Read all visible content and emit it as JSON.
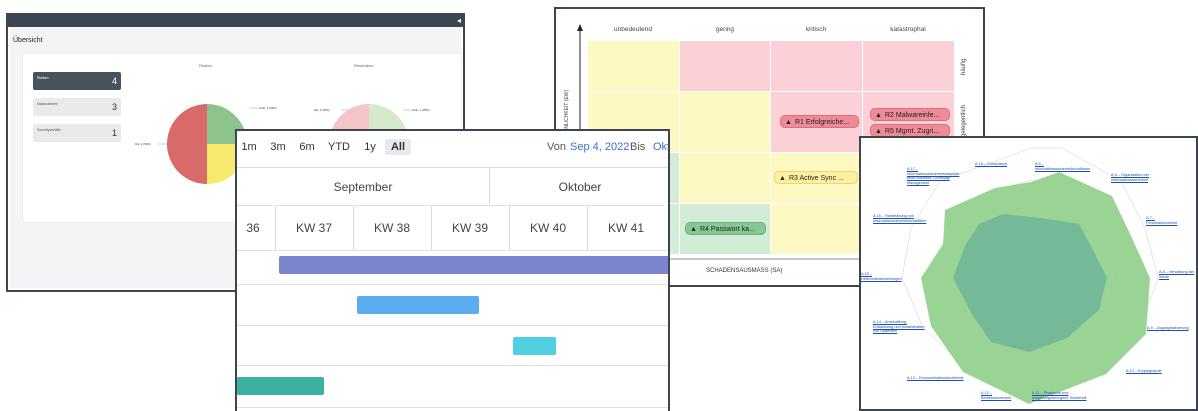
{
  "dashboard": {
    "title": "Übersicht",
    "stats": [
      {
        "label": "Risiken",
        "value": "4"
      },
      {
        "label": "Massnahmen",
        "value": "3"
      },
      {
        "label": "Securityvorfälle",
        "value": "1"
      }
    ],
    "charts": [
      {
        "title": "Risiken",
        "labels": [
          "Gelb: 1 (25%)",
          "Rot: 2 (50%)",
          "Grün: 1 (25%)"
        ]
      },
      {
        "title": "Restrisiken",
        "labels": [
          "Gelb: 1 (25%)",
          "Rot: 2 (50%)",
          "Grün: 1 (25%)"
        ]
      }
    ],
    "colors": {
      "red": "#d86a6a",
      "green": "#8dc48c",
      "yellow": "#f7ea6d",
      "red_light": "#f4c5c9",
      "green_light": "#d5e8cc"
    }
  },
  "risk_matrix": {
    "columns": [
      "unbedeutend",
      "gering",
      "kritisch",
      "katastrophal"
    ],
    "rows": [
      "häufig",
      "gelegentlich"
    ],
    "y_axis_label": "WAHRSCHEINLICHKEIT (EW)",
    "x_axis_label": "SCHADENSAUSMASS (SA)",
    "risks": [
      {
        "id": "R1",
        "label": "R1 Erfolgreiche...",
        "level": "red"
      },
      {
        "id": "R2",
        "label": "R2 Malwareinfe...",
        "level": "red"
      },
      {
        "id": "R5",
        "label": "R5 Mgmt. Zugri...",
        "level": "red"
      },
      {
        "id": "R3",
        "label": "R3 Active Sync ...",
        "level": "yellow"
      },
      {
        "id": "R4",
        "label": "R4 Passwort ka...",
        "level": "green"
      }
    ]
  },
  "gantt": {
    "ranges": [
      "1m",
      "3m",
      "6m",
      "YTD",
      "1y",
      "All"
    ],
    "selected_range": "All",
    "from_label": "Von",
    "from_date": "Sep 4, 2022",
    "to_label": "Bis",
    "to_date": "Okt",
    "months": [
      "September",
      "Oktober"
    ],
    "weeks": [
      "36",
      "KW 37",
      "KW 38",
      "KW 39",
      "KW 40",
      "KW 41"
    ],
    "bar_colors": [
      "#7c83cf",
      "#5aaef0",
      "#4fcfe0",
      "#3bb19f"
    ]
  },
  "radar": {
    "labels": [
      "A.18 – Compliance",
      "A.5 – Informationssicherheitsrichtlinien",
      "A.6 – Organisation der Informationssicherheit",
      "A.7 – Personalsicherheit",
      "A.8 – Verwaltung der Werte",
      "A.9 – Zugangssteuerung",
      "A.10 – Kryptographie",
      "A.11 – Physische und umgebungsbezogene Sicherheit",
      "A.12 – Betriebssicherheit",
      "A.13 – Kommunikationssicherheit",
      "A.14 – Anschaffung, Entwicklung und Instandhalten von Systemen",
      "A.15 – Lieferantenbeziehungen",
      "A.16 – Handhabung von Informationssicherheitsvorfällen",
      "A.17 – Informationssicherheitsaspekte beim Business Continuity Management"
    ],
    "colors": {
      "outer": "#8fcf8a",
      "inner": "#6fb49a"
    }
  }
}
